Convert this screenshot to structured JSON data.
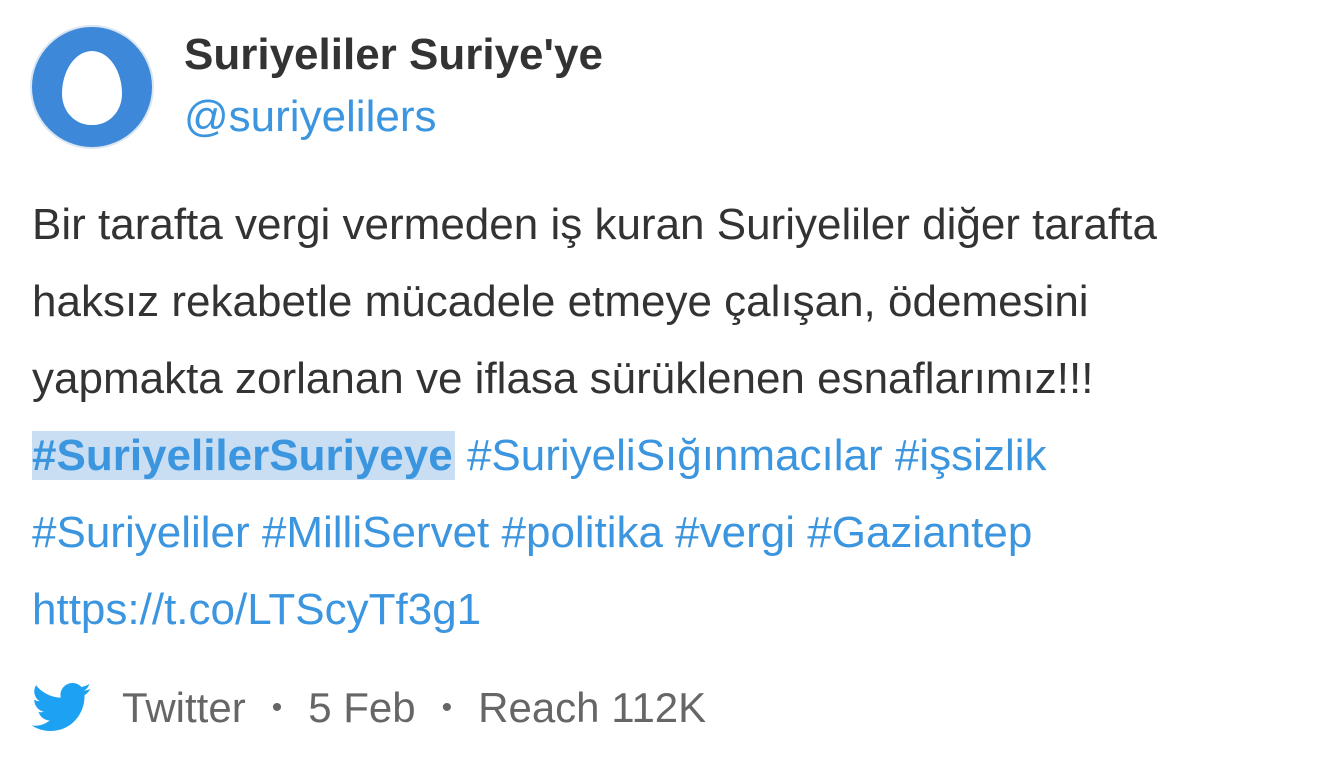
{
  "author": {
    "display_name": "Suriyeliler Suriye'ye",
    "handle": "@suriyelilers"
  },
  "tweet": {
    "line1": "Bir tarafta vergi vermeden iş kuran Suriyeliler diğer tarafta",
    "line2": "haksız rekabetle mücadele etmeye çalışan, ödemesini",
    "line3": "yapmakta zorlanan ve iflasa sürüklenen esnaflarımız!!!",
    "hashtags_line1": [
      "#SuriyelilerSuriyeye",
      "#SuriyeliSığınmacılar",
      "#işsizlik"
    ],
    "hashtags_line2": [
      "#Suriyeliler",
      "#MilliServet",
      "#politika",
      "#vergi",
      "#Gaziantep"
    ],
    "link": "https://t.co/LTScyTf3g1"
  },
  "footer": {
    "source_icon": "twitter-bird-icon",
    "source": "Twitter",
    "separator": "•",
    "date": "5 Feb",
    "reach": "Reach 112K"
  },
  "colors": {
    "link": "#3b95df",
    "text": "#333333",
    "meta": "#666666",
    "highlight": "#c9def3",
    "avatar": "#3d88d8",
    "twitter_blue": "#1da1f2"
  }
}
